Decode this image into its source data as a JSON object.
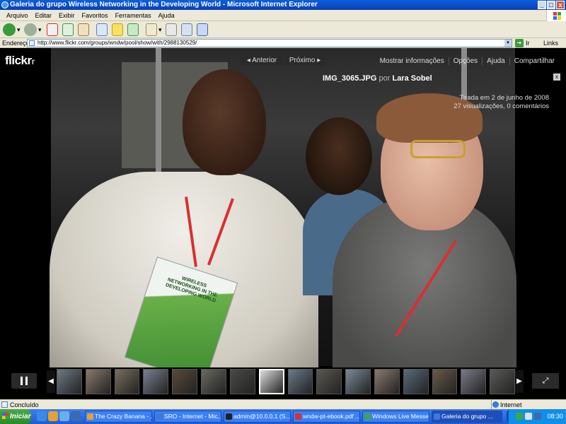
{
  "window": {
    "title": "Galeria do grupo Wireless Networking in the Developing World - Microsoft Internet Explorer",
    "minimize": "_",
    "maximize": "□",
    "close": "x"
  },
  "menu": [
    "Arquivo",
    "Editar",
    "Exibir",
    "Favoritos",
    "Ferramentas",
    "Ajuda"
  ],
  "address": {
    "label": "Endereço",
    "url": "http://www.flickr.com/groups/wndw/pool/show/with/2988130529/",
    "go": "Ir",
    "links": "Links"
  },
  "flickr": {
    "logo": "flickr",
    "prev": "◂ Anterior",
    "next": "Próximo ▸",
    "top_links": [
      "Mostrar informações",
      "Opções",
      "Ajuda",
      "Compartilhar"
    ],
    "photo_name": "IMG_3065.JPG",
    "by": "por",
    "author": "Lara Sobel",
    "close": "x",
    "taken": "Tirada em 2 de junho de 2008",
    "stats": "27 visualizações, 0 comentários",
    "book_title": "WIRELESS NETWORKING IN THE DEVELOPING WORLD",
    "fullscreen": "⤢"
  },
  "thumb_colors": [
    "#6d7a86",
    "#8a7a6a",
    "#7a6e5a",
    "#7a8090",
    "#5a4a3a",
    "#6a6a60",
    "#4a4a48",
    "#ddd",
    "#6a7a8a",
    "#5a5850",
    "#7a8a9a",
    "#8a7a6e",
    "#5a6a7a",
    "#6a5a4a",
    "#7a7a8a",
    "#5a5a58"
  ],
  "thumb_active_index": 7,
  "status": {
    "text": "Concluído",
    "zone": "Internet"
  },
  "taskbar": {
    "start": "Iniciar",
    "items": [
      {
        "label": "The Crazy Banana - ...",
        "color": "#e8a030"
      },
      {
        "label": "SRO - Internet - Mic...",
        "color": "#3a7ad8"
      },
      {
        "label": "admin@10.0.0.1 (S...",
        "color": "#222"
      },
      {
        "label": "wndw-pt-ebook.pdf ...",
        "color": "#d83030"
      },
      {
        "label": "Windows Live Messe...",
        "color": "#3aa84a"
      },
      {
        "label": "Galeria do grupo ...",
        "color": "#3a7ad8"
      }
    ],
    "lang": "PT",
    "tray_arrow": "«",
    "clock": "08:30"
  }
}
